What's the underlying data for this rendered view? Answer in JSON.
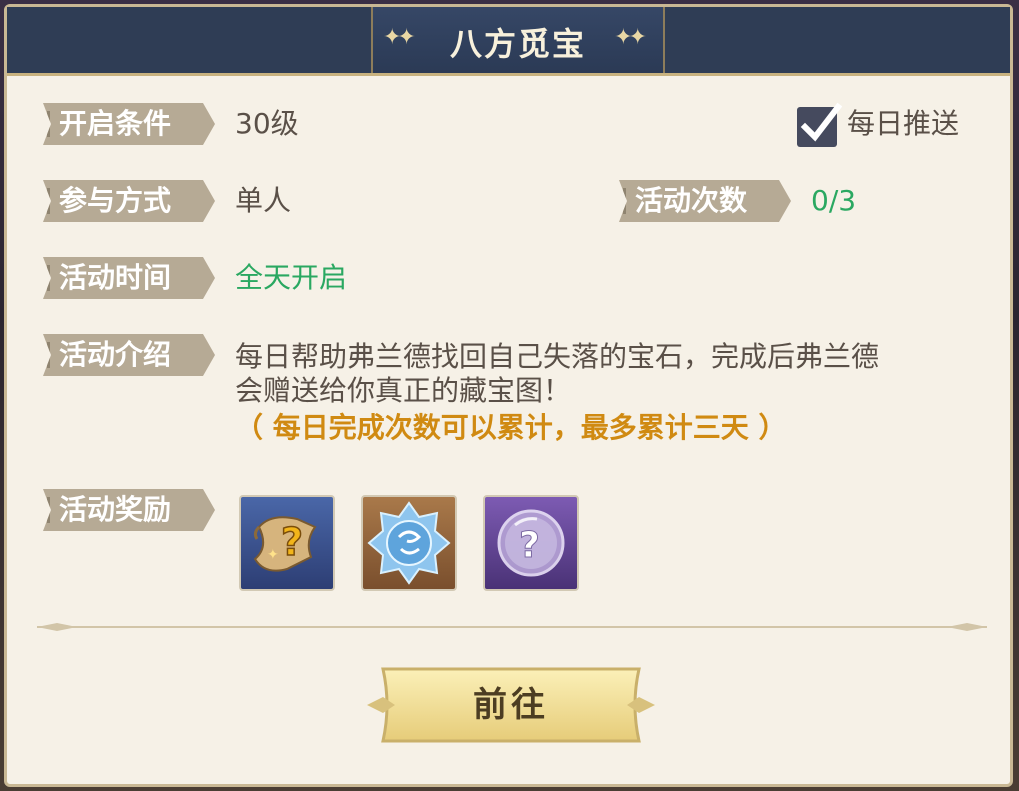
{
  "window": {
    "title": "八方觅宝"
  },
  "info": {
    "open_condition": {
      "label": "开启条件",
      "value": "30级"
    },
    "participation": {
      "label": "参与方式",
      "value": "单人"
    },
    "activity_count": {
      "label": "活动次数",
      "value": "0/3"
    },
    "activity_time": {
      "label": "活动时间",
      "value": "全天开启"
    },
    "intro": {
      "label": "活动介绍",
      "line1": "每日帮助弗兰德找回自己失落的宝石，完成后弗兰德",
      "line2": "会赠送给你真正的藏宝图！",
      "note": "（ 每日完成次数可以累计，最多累计三天 ）"
    },
    "rewards": {
      "label": "活动奖励"
    }
  },
  "daily_push": {
    "label": "每日推送",
    "checked": true
  },
  "rewards": [
    {
      "icon": "treasure-map-scroll-icon"
    },
    {
      "icon": "blue-gem-icon"
    },
    {
      "icon": "mystery-bubble-icon"
    }
  ],
  "actions": {
    "go_label": "前往"
  },
  "colors": {
    "header": "#2f3d55",
    "panel": "#f6f1e7",
    "green": "#2aa861",
    "orange": "#d08a12"
  }
}
